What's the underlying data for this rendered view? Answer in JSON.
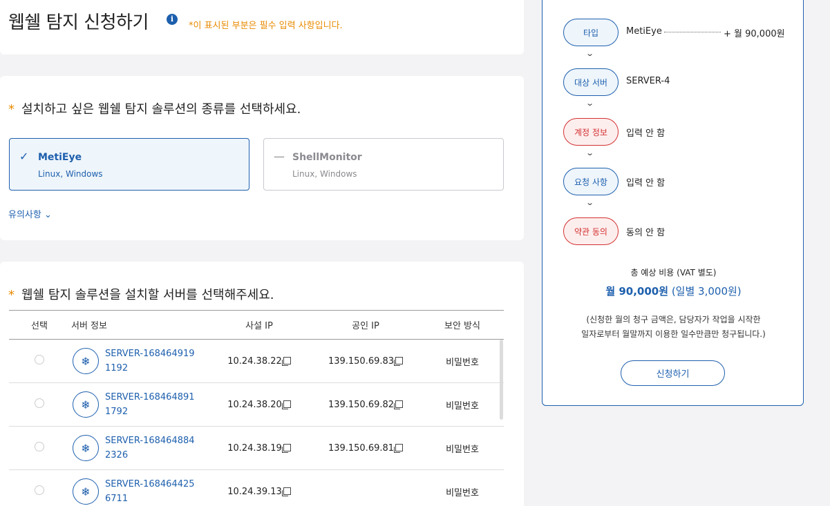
{
  "header": {
    "title": "웹쉘 탐지 신청하기",
    "info_icon": "i",
    "required_note": "*이 표시된 부분은 필수 입력 사항입니다."
  },
  "solution": {
    "star": "*",
    "question": "설치하고 싶은 웹쉘 탐지 솔루션의 종류를 선택하세요.",
    "options": [
      {
        "mark": "✓",
        "name": "MetiEye",
        "os": "Linux, Windows",
        "selected": true
      },
      {
        "mark": "—",
        "name": "ShellMonitor",
        "os": "Linux, Windows",
        "selected": false
      }
    ],
    "notice_link": "유의사항 ⌄"
  },
  "server": {
    "star": "*",
    "question": "웹쉘 탐지 솔루션을 설치할 서버를 선택해주세요.",
    "columns": [
      "선택",
      "서버 정보",
      "사설 IP",
      "공인 IP",
      "보안 방식"
    ],
    "rows": [
      {
        "name": "SERVER-1684649191192",
        "private_ip": "10.24.38.22",
        "public_ip": "139.150.69.83",
        "security": "비밀번호"
      },
      {
        "name": "SERVER-1684648911792",
        "private_ip": "10.24.38.20",
        "public_ip": "139.150.69.82",
        "security": "비밀번호"
      },
      {
        "name": "SERVER-1684648842326",
        "private_ip": "10.24.38.19",
        "public_ip": "139.150.69.81",
        "security": "비밀번호"
      },
      {
        "name": "SERVER-1684644256711",
        "private_ip": "10.24.39.13",
        "public_ip": "",
        "security": "비밀번호"
      }
    ],
    "server_icon": "❄"
  },
  "summary": {
    "steps": [
      {
        "label": "타입",
        "value": "MetiEye",
        "color": "blue"
      },
      {
        "label": "대상 서버",
        "value": "SERVER-4",
        "color": "blue"
      },
      {
        "label": "계정 정보",
        "value": "입력 안 함",
        "color": "red"
      },
      {
        "label": "요청 사항",
        "value": "입력 안 함",
        "color": "blue"
      },
      {
        "label": "약관 동의",
        "value": "동의 안 함",
        "color": "red"
      }
    ],
    "chevron": "⌄",
    "price": "+ 월 90,000원",
    "total_label": "총 예상 비용 (VAT 별도)",
    "total_monthly": "월 90,000원",
    "total_daily": "(일별 3,000원)",
    "note_line1": "(신청한 월의 청구 금액은, 담당자가 작업을 시작한",
    "note_line2": "일자로부터 월말까지 이용한 일수만큼만 청구됩니다.)",
    "apply_label": "신청하기"
  },
  "colors": {
    "accent": "#1d5fad",
    "warning": "#e88a00",
    "danger": "#d32f2f"
  }
}
